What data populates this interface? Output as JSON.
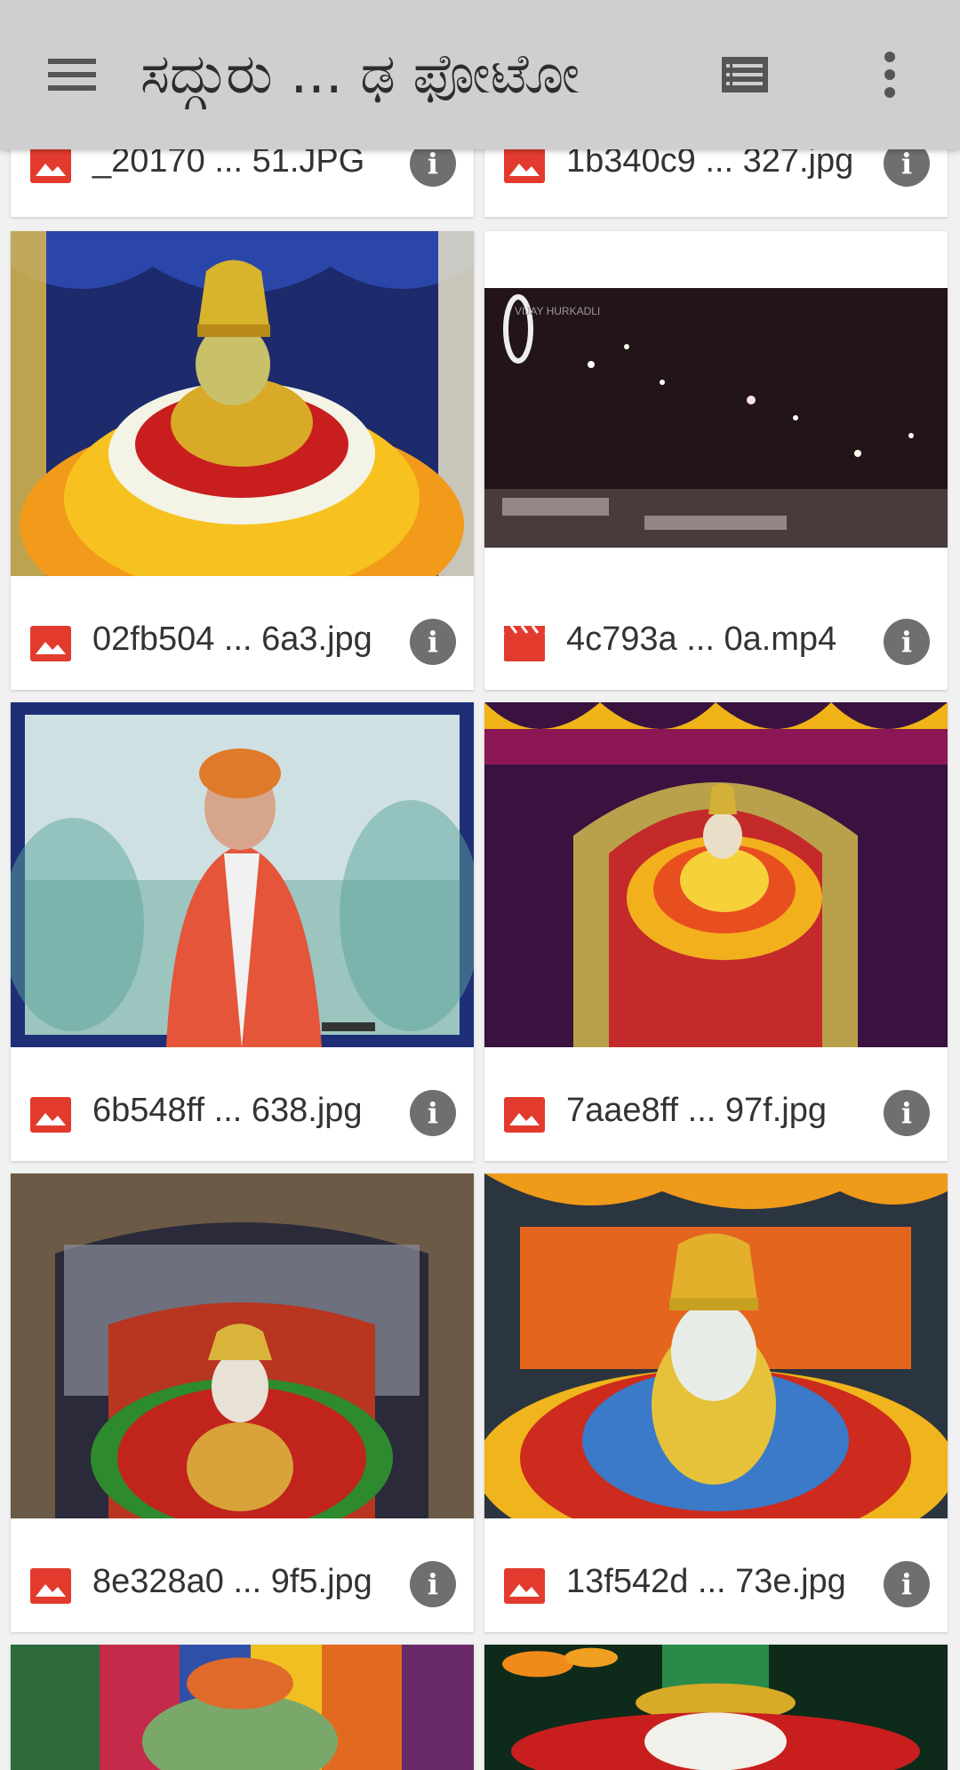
{
  "appbar": {
    "title": "ಸದ್ಗುರು ... ಢ ಫೋಟೋ",
    "menu_icon": "hamburger-menu-icon",
    "view_icon": "list-view-icon",
    "more_icon": "more-vert-icon"
  },
  "files": [
    {
      "name": "_20170 ... 51.JPG",
      "type": "image"
    },
    {
      "name": "1b340c9 ... 327.jpg",
      "type": "image"
    },
    {
      "name": "02fb504 ... 6a3.jpg",
      "type": "image"
    },
    {
      "name": "4c793a ... 0a.mp4",
      "type": "video",
      "watermark": "VIJAY HURKADLI"
    },
    {
      "name": "6b548ff ... 638.jpg",
      "type": "image"
    },
    {
      "name": "7aae8ff ... 97f.jpg",
      "type": "image"
    },
    {
      "name": "8e328a0 ... 9f5.jpg",
      "type": "image"
    },
    {
      "name": "13f542d ... 73e.jpg",
      "type": "image"
    },
    {
      "name": "",
      "type": "image"
    },
    {
      "name": "",
      "type": "image"
    }
  ],
  "info_label": "i",
  "colors": {
    "appbar": "#cfcfcf",
    "file_icon": "#e23b2e",
    "info_button": "#6f6f6f",
    "background": "#f1f1f1"
  }
}
